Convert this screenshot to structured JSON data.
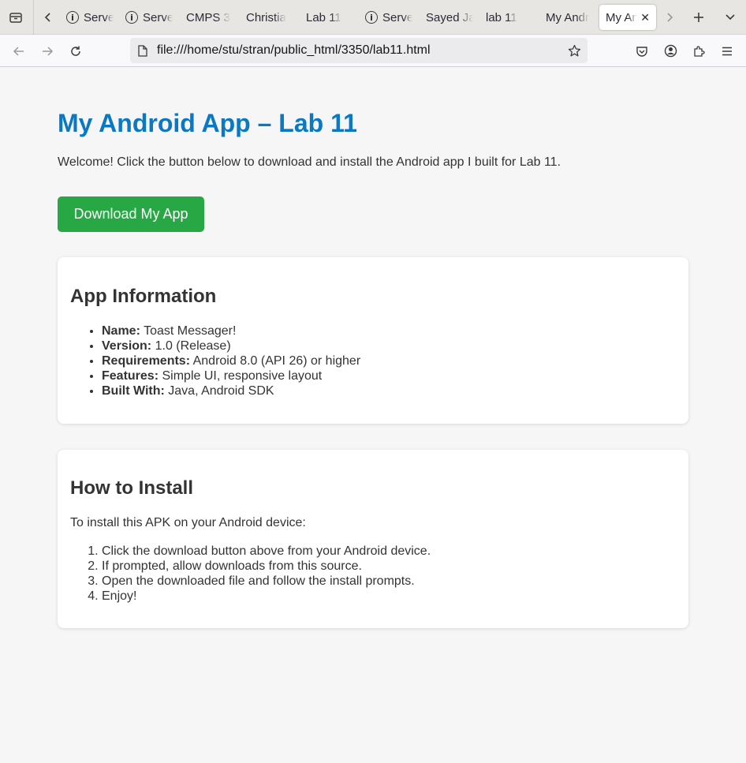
{
  "browser": {
    "tabs": [
      {
        "label": "Serve",
        "favicon": "info-icon"
      },
      {
        "label": "Serve",
        "favicon": "info-icon"
      },
      {
        "label": "CMPS 3",
        "favicon": ""
      },
      {
        "label": "Christia",
        "favicon": ""
      },
      {
        "label": "Lab 11",
        "favicon": ""
      },
      {
        "label": "Serve",
        "favicon": "info-icon"
      },
      {
        "label": "Sayed Ja",
        "favicon": ""
      },
      {
        "label": "lab 11",
        "favicon": ""
      },
      {
        "label": "My Andr",
        "favicon": ""
      },
      {
        "label": "My An",
        "favicon": "",
        "active": true
      }
    ],
    "url": "file:///home/stu/stran/public_html/3350/lab11.html"
  },
  "page": {
    "title": "My Android App – Lab 11",
    "intro": "Welcome! Click the button below to download and install the Android app I built for Lab 11.",
    "download_label": "Download My App",
    "info": {
      "heading": "App Information",
      "items": [
        {
          "label": "Name:",
          "value": "Toast Messager!"
        },
        {
          "label": "Version:",
          "value": "1.0 (Release)"
        },
        {
          "label": "Requirements:",
          "value": "Android 8.0 (API 26) or higher"
        },
        {
          "label": "Features:",
          "value": "Simple UI, responsive layout"
        },
        {
          "label": "Built With:",
          "value": "Java, Android SDK"
        }
      ]
    },
    "install": {
      "heading": "How to Install",
      "intro": "To install this APK on your Android device:",
      "steps": [
        "Click the download button above from your Android device.",
        "If prompted, allow downloads from this source.",
        "Open the downloaded file and follow the install prompts.",
        "Enjoy!"
      ]
    }
  },
  "colors": {
    "title": "#0a78c2",
    "button": "#28a745"
  }
}
